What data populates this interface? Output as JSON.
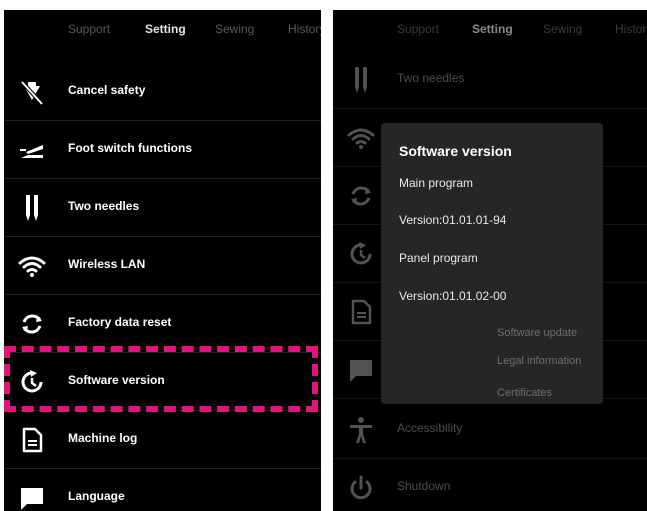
{
  "tabs": [
    "Support",
    "Setting",
    "Sewing",
    "History"
  ],
  "active_tab": "Setting",
  "left_items": [
    {
      "label": "Cancel safety",
      "icon": "cancel-safety-icon"
    },
    {
      "label": "Foot switch functions",
      "icon": "foot-switch-icon"
    },
    {
      "label": "Two needles",
      "icon": "two-needles-icon"
    },
    {
      "label": "Wireless LAN",
      "icon": "wifi-icon"
    },
    {
      "label": "Factory data reset",
      "icon": "reset-icon"
    },
    {
      "label": "Software version",
      "icon": "software-version-icon"
    },
    {
      "label": "Machine log",
      "icon": "document-icon"
    },
    {
      "label": "Language",
      "icon": "chat-icon"
    }
  ],
  "right_items": [
    {
      "label": "Two needles",
      "icon": "two-needles-icon"
    },
    {
      "label": "",
      "icon": "wifi-icon"
    },
    {
      "label": "",
      "icon": "reset-icon"
    },
    {
      "label": "",
      "icon": "software-version-icon"
    },
    {
      "label": "",
      "icon": "document-icon"
    },
    {
      "label": "",
      "icon": "chat-icon"
    },
    {
      "label": "Accessibility",
      "icon": "accessibility-icon"
    },
    {
      "label": "Shutdown",
      "icon": "power-icon"
    }
  ],
  "highlight_color": "#e0137f",
  "dialog": {
    "title": "Software version",
    "main_program_label": "Main program",
    "main_program_version": "Version:01.01.01-94",
    "panel_program_label": "Panel program",
    "panel_program_version": "Version:01.01.02-00",
    "links": [
      "Software update",
      "Legal information",
      "Certificates"
    ]
  }
}
